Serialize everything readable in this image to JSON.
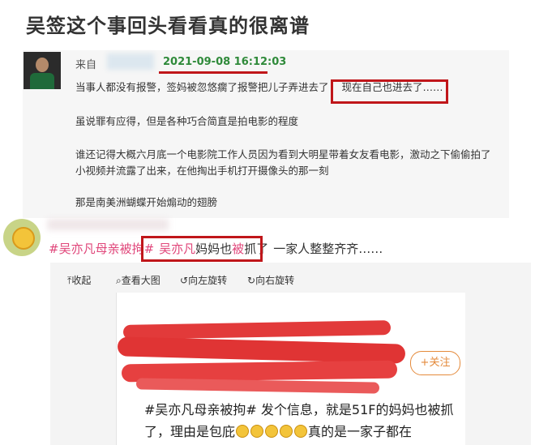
{
  "title": "吴签这个事回头看看真的很离谱",
  "post1": {
    "from_label": "来自",
    "time": "2021-09-08 16:12:03",
    "line1_a": "当事人都没有报警，签妈被忽悠瘸了报警把儿子弄进去了",
    "line1_b": "现在自己也进去了……",
    "line2": "虽说罪有应得，但是各种巧合简直是拍电影的程度",
    "line3": "谁还记得大概六月底一个电影院工作人员因为看到大明星带着女友看电影，激动之下偷偷拍了小视频并流露了出来，在他掏出手机打开摄像头的那一刻",
    "line4": "那是南美洲蝴蝶开始煽动的翅膀"
  },
  "post2": {
    "hashtag": "#吴亦凡母亲被拘#",
    "highlight_a": "吴亦凡",
    "highlight_b": "妈妈也",
    "highlight_c": "被",
    "highlight_d": "抓了",
    "rest": "一家人整整齐齐……"
  },
  "toolbar": {
    "collapse": "收起",
    "view_large": "查看大图",
    "rotate_left": "向左旋转",
    "rotate_right": "向右旋转"
  },
  "screenshot": {
    "follow_label": "+关注",
    "text_a": "#吴亦凡母亲被拘# 发个信息，就是51F的妈妈也被抓了，理由是包庇",
    "text_b": "真的是一家子都在"
  },
  "icons": [
    "collapse-icon",
    "search-icon",
    "rotate-left-icon",
    "rotate-right-icon",
    "emoji-icon"
  ],
  "colors": {
    "highlight_box": "#c0161a",
    "time": "#2f8a3a",
    "hashtag": "#e0467a",
    "follow": "#e48a3b"
  }
}
